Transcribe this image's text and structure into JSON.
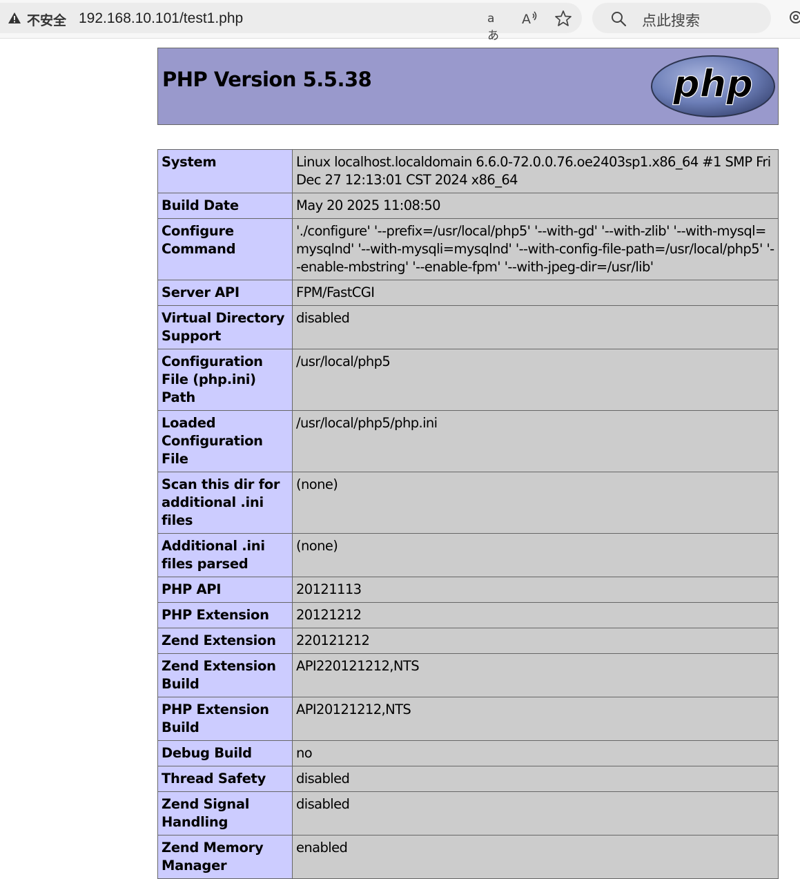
{
  "browser": {
    "insecure_label": "不安全",
    "url": "192.168.10.101/test1.php",
    "translate_glyph": "aあ",
    "search_placeholder": "点此搜索",
    "icons": [
      "warning-icon",
      "translate-icon",
      "read-aloud-icon",
      "favorite-star-icon",
      "search-icon",
      "settings-icon"
    ]
  },
  "phpinfo": {
    "title": "PHP Version 5.5.38",
    "logo_text": "php",
    "colors": {
      "header": "#9999cc",
      "key_cell": "#ccccff",
      "value_cell": "#cccccc",
      "logo": "#6c7eb7"
    },
    "rows": [
      {
        "key": "System",
        "value": "Linux localhost.localdomain 6.6.0-72.0.0.76.oe2403sp1.x86_64 #1 SMP Fri Dec 27 12:13:01 CST 2024 x86_64"
      },
      {
        "key": "Build Date",
        "value": "May 20 2025 11:08:50"
      },
      {
        "key": "Configure Command",
        "value": "'./configure' '--prefix=/usr/local/php5' '--with-gd' '--with-zlib' '--with-mysql=mysqlnd' '--with-mysqli=mysqlnd' '--with-config-file-path=/usr/local/php5' '--enable-mbstring' '--enable-fpm' '--with-jpeg-dir=/usr/lib'"
      },
      {
        "key": "Server API",
        "value": "FPM/FastCGI"
      },
      {
        "key": "Virtual Directory Support",
        "value": "disabled"
      },
      {
        "key": "Configuration File (php.ini) Path",
        "value": "/usr/local/php5"
      },
      {
        "key": "Loaded Configuration File",
        "value": "/usr/local/php5/php.ini"
      },
      {
        "key": "Scan this dir for additional .ini files",
        "value": "(none)"
      },
      {
        "key": "Additional .ini files parsed",
        "value": "(none)"
      },
      {
        "key": "PHP API",
        "value": "20121113"
      },
      {
        "key": "PHP Extension",
        "value": "20121212"
      },
      {
        "key": "Zend Extension",
        "value": "220121212"
      },
      {
        "key": "Zend Extension Build",
        "value": "API220121212,NTS"
      },
      {
        "key": "PHP Extension Build",
        "value": "API20121212,NTS"
      },
      {
        "key": "Debug Build",
        "value": "no"
      },
      {
        "key": "Thread Safety",
        "value": "disabled"
      },
      {
        "key": "Zend Signal Handling",
        "value": "disabled"
      },
      {
        "key": "Zend Memory Manager",
        "value": "enabled"
      }
    ]
  }
}
